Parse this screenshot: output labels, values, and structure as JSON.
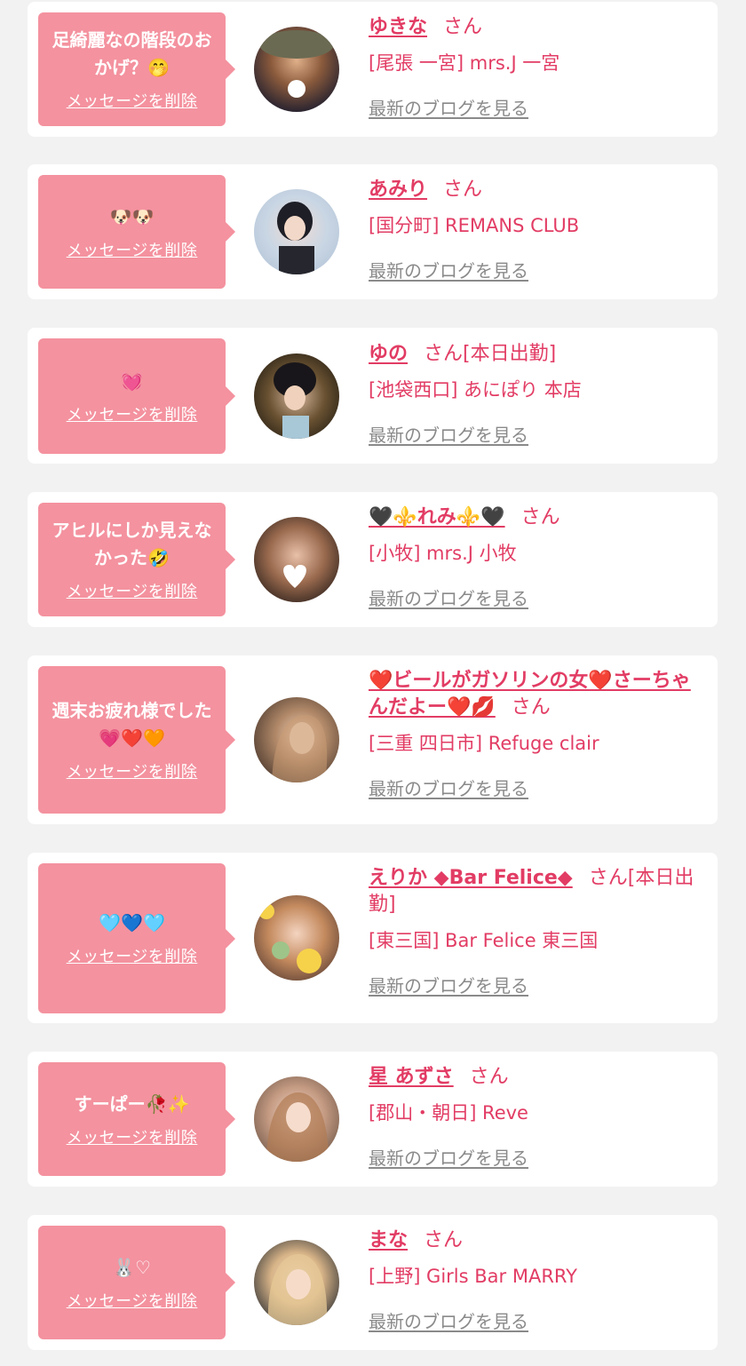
{
  "delete_label": "メッセージを削除",
  "blog_label": "最新のブログを見る",
  "san_label": "さん",
  "items": [
    {
      "message": "足綺麗なの階段のおかげ？🤭",
      "name": "ゆきな",
      "status": "",
      "shop": "[尾張 一宮] mrs.J 一宮"
    },
    {
      "message": "🐶🐶",
      "name": "あみり",
      "status": "",
      "shop": "[国分町] REMANS CLUB"
    },
    {
      "message": "💓",
      "name": "ゆの",
      "status": "[本日出勤]",
      "shop": "[池袋西口] あにぽり 本店"
    },
    {
      "message": "アヒルにしか見えなかった🤣",
      "name": "🖤⚜️れみ⚜️🖤",
      "status": "",
      "shop": "[小牧] mrs.J 小牧"
    },
    {
      "message": "週末お疲れ様でした💗❤️🧡",
      "name": "❤️ビールがガソリンの女❤️さーちゃんだよー❤️💋",
      "status": "",
      "shop": "[三重 四日市] Refuge clair"
    },
    {
      "message": "🩵💙🩵",
      "name": "えりか ◆Bar Felice◆",
      "status": "[本日出勤]",
      "shop": "[東三国] Bar Felice 東三国"
    },
    {
      "message": "すーぱー🥀✨",
      "name": "星 あずさ",
      "status": "",
      "shop": "[郡山・朝日] Reve"
    },
    {
      "message": "🐰♡",
      "name": "まな",
      "status": "",
      "shop": "[上野] Girls Bar MARRY"
    }
  ],
  "colors": {
    "accent": "#e23c64",
    "bubble": "#f4929f",
    "link_gray": "#8a8a8a",
    "background": "#f2f2f2"
  }
}
